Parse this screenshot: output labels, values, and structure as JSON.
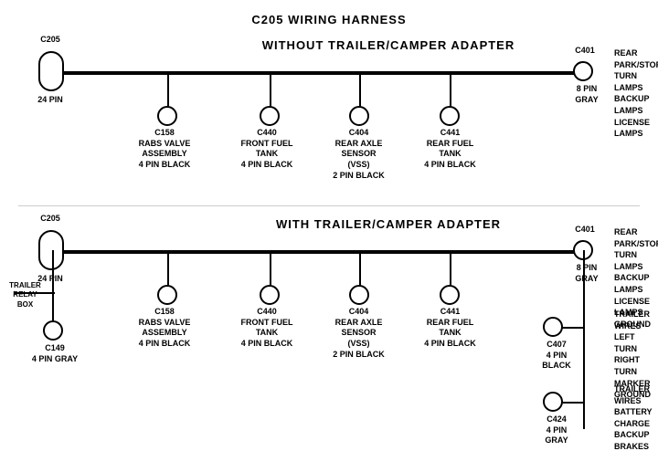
{
  "title": "C205 WIRING HARNESS",
  "section1": {
    "label": "WITHOUT  TRAILER/CAMPER  ADAPTER",
    "connectors": [
      {
        "id": "C205_1",
        "label": "C205",
        "sublabel": "24 PIN"
      },
      {
        "id": "C401_1",
        "label": "C401",
        "sublabel": "8 PIN\nGRAY"
      },
      {
        "id": "C158_1",
        "label": "C158",
        "sublabel": "RABS VALVE\nASSEMBLY\n4 PIN BLACK"
      },
      {
        "id": "C440_1",
        "label": "C440",
        "sublabel": "FRONT FUEL\nTANK\n4 PIN BLACK"
      },
      {
        "id": "C404_1",
        "label": "C404",
        "sublabel": "REAR AXLE\nSENSOR\n(VSS)\n2 PIN BLACK"
      },
      {
        "id": "C441_1",
        "label": "C441",
        "sublabel": "REAR FUEL\nTANK\n4 PIN BLACK"
      }
    ],
    "right_label": "REAR PARK/STOP\nTURN LAMPS\nBACKUP LAMPS\nLICENSE LAMPS"
  },
  "section2": {
    "label": "WITH  TRAILER/CAMPER  ADAPTER",
    "connectors": [
      {
        "id": "C205_2",
        "label": "C205",
        "sublabel": "24 PIN"
      },
      {
        "id": "C401_2",
        "label": "C401",
        "sublabel": "8 PIN\nGRAY"
      },
      {
        "id": "C149",
        "label": "C149",
        "sublabel": "4 PIN GRAY"
      },
      {
        "id": "C158_2",
        "label": "C158",
        "sublabel": "RABS VALVE\nASSEMBLY\n4 PIN BLACK"
      },
      {
        "id": "C440_2",
        "label": "C440",
        "sublabel": "FRONT FUEL\nTANK\n4 PIN BLACK"
      },
      {
        "id": "C404_2",
        "label": "C404",
        "sublabel": "REAR AXLE\nSENSOR\n(VSS)\n2 PIN BLACK"
      },
      {
        "id": "C441_2",
        "label": "C441",
        "sublabel": "REAR FUEL\nTANK\n4 PIN BLACK"
      },
      {
        "id": "C407",
        "label": "C407",
        "sublabel": "4 PIN\nBLACK"
      },
      {
        "id": "C424",
        "label": "C424",
        "sublabel": "4 PIN\nGRAY"
      }
    ],
    "right_label1": "REAR PARK/STOP\nTURN LAMPS\nBACKUP LAMPS\nLICENSE LAMPS\nGROUND",
    "right_label2": "TRAILER WIRES\nLEFT TURN\nRIGHT TURN\nMARKER\nGROUND",
    "right_label3": "TRAILER WIRES\nBATTERY CHARGE\nBACKUP\nBRAKES",
    "trailer_relay": "TRAILER\nRELAY\nBOX"
  }
}
